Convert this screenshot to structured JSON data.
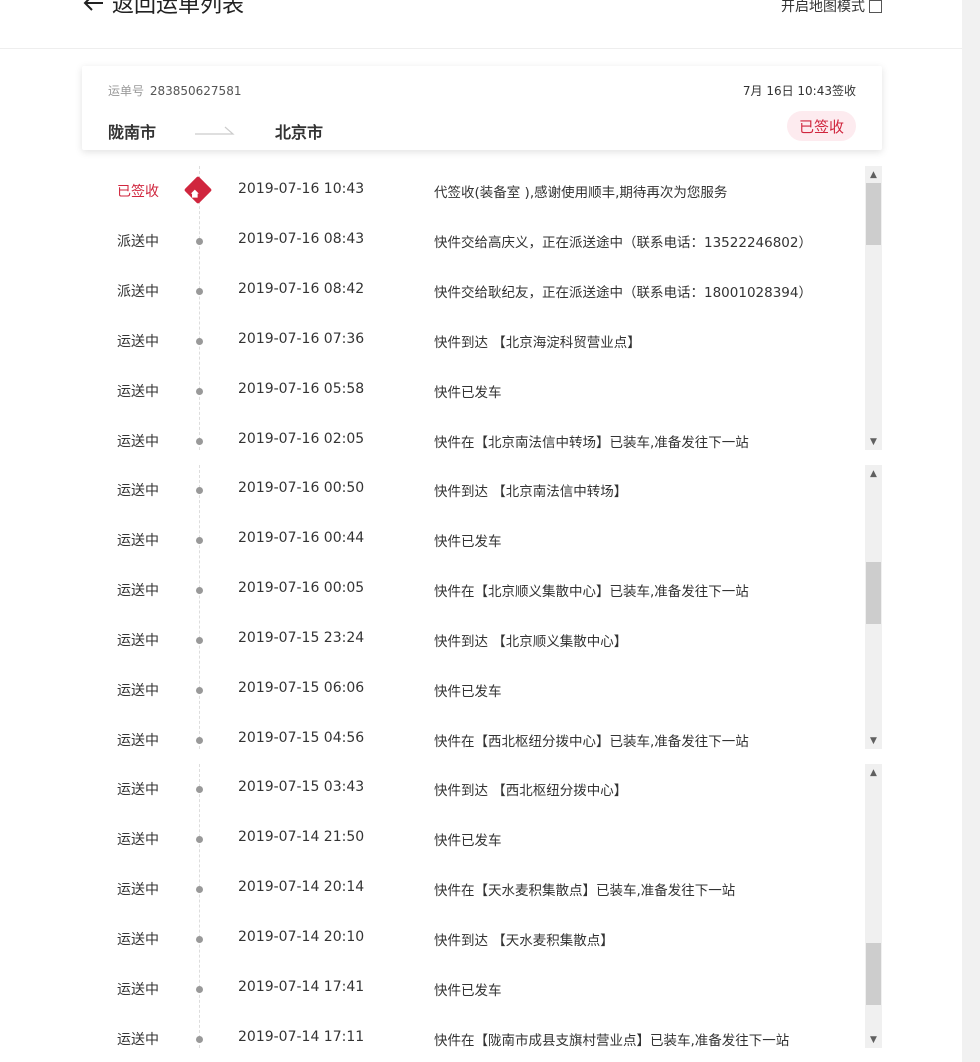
{
  "header": {
    "back_label": "返回运单列表",
    "map_mode_label": "开启地图模式"
  },
  "card": {
    "waybill_label": "运单号",
    "waybill_number": "283850627581",
    "sign_time": "7月 16日 10:43签收",
    "from_city": "陇南市",
    "to_city": "北京市",
    "status_badge": "已签收"
  },
  "colors": {
    "accent": "#d0263e",
    "badge_bg": "#fdebef",
    "dot": "#999999"
  },
  "tracking": {
    "panels": [
      {
        "events": [
          {
            "status": "已签收",
            "time": "2019-07-16 10:43",
            "desc": "代签收(装备室 ),感谢使用顺丰,期待再次为您服务",
            "icon": "home-icon"
          },
          {
            "status": "派送中",
            "time": "2019-07-16 08:43",
            "desc": "快件交给高庆义，正在派送途中（联系电话：13522246802）"
          },
          {
            "status": "派送中",
            "time": "2019-07-16 08:42",
            "desc": "快件交给耿纪友，正在派送途中（联系电话：18001028394）"
          },
          {
            "status": "运送中",
            "time": "2019-07-16 07:36",
            "desc": "快件到达 【北京海淀科贸营业点】"
          },
          {
            "status": "运送中",
            "time": "2019-07-16 05:58",
            "desc": "快件已发车"
          },
          {
            "status": "运送中",
            "time": "2019-07-16 02:05",
            "desc": "快件在【北京南法信中转场】已装车,准备发往下一站"
          }
        ]
      },
      {
        "events": [
          {
            "status": "运送中",
            "time": "2019-07-16 00:50",
            "desc": "快件到达 【北京南法信中转场】"
          },
          {
            "status": "运送中",
            "time": "2019-07-16 00:44",
            "desc": "快件已发车"
          },
          {
            "status": "运送中",
            "time": "2019-07-16 00:05",
            "desc": "快件在【北京顺义集散中心】已装车,准备发往下一站"
          },
          {
            "status": "运送中",
            "time": "2019-07-15 23:24",
            "desc": "快件到达 【北京顺义集散中心】"
          },
          {
            "status": "运送中",
            "time": "2019-07-15 06:06",
            "desc": "快件已发车"
          },
          {
            "status": "运送中",
            "time": "2019-07-15 04:56",
            "desc": "快件在【西北枢纽分拨中心】已装车,准备发往下一站"
          }
        ]
      },
      {
        "events": [
          {
            "status": "运送中",
            "time": "2019-07-15 03:43",
            "desc": "快件到达 【西北枢纽分拨中心】"
          },
          {
            "status": "运送中",
            "time": "2019-07-14 21:50",
            "desc": "快件已发车"
          },
          {
            "status": "运送中",
            "time": "2019-07-14 20:14",
            "desc": "快件在【天水麦积集散点】已装车,准备发往下一站"
          },
          {
            "status": "运送中",
            "time": "2019-07-14 20:10",
            "desc": "快件到达 【天水麦积集散点】"
          },
          {
            "status": "运送中",
            "time": "2019-07-14 17:41",
            "desc": "快件已发车"
          },
          {
            "status": "运送中",
            "time": "2019-07-14 17:11",
            "desc": "快件在【陇南市成县支旗村营业点】已装车,准备发往下一站"
          }
        ]
      }
    ]
  }
}
